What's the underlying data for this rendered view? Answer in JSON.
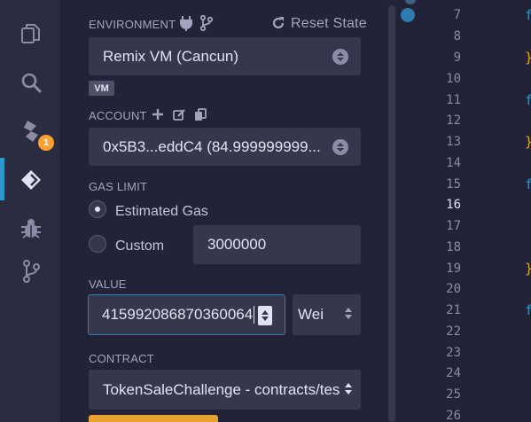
{
  "rail": {
    "items": [
      "file-explorer",
      "search",
      "compiler",
      "deploy-run",
      "debugger",
      "git"
    ],
    "badge": "1"
  },
  "environment": {
    "label": "ENVIRONMENT",
    "reset": "Reset State",
    "value": "Remix VM (Cancun)",
    "badge": "VM"
  },
  "account": {
    "label": "ACCOUNT",
    "value": "0x5B3...eddC4 (84.999999999..."
  },
  "gas": {
    "label": "GAS LIMIT",
    "estimated": "Estimated Gas",
    "custom": "Custom",
    "value": "3000000"
  },
  "value": {
    "label": "VALUE",
    "amount": "415992086870360064",
    "unit": "Wei"
  },
  "contract": {
    "label": "CONTRACT",
    "value": "TokenSaleChallenge - contracts/tes"
  },
  "editor": {
    "lines": [
      "7",
      "8",
      "9",
      "10",
      "11",
      "12",
      "13",
      "14",
      "15",
      "16",
      "17",
      "18",
      "19",
      "20",
      "21",
      "22",
      "23",
      "24",
      "25",
      "26"
    ],
    "current_line": "16"
  },
  "colors": {
    "accent": "#2d97c9",
    "badge": "#ff9f2e"
  }
}
